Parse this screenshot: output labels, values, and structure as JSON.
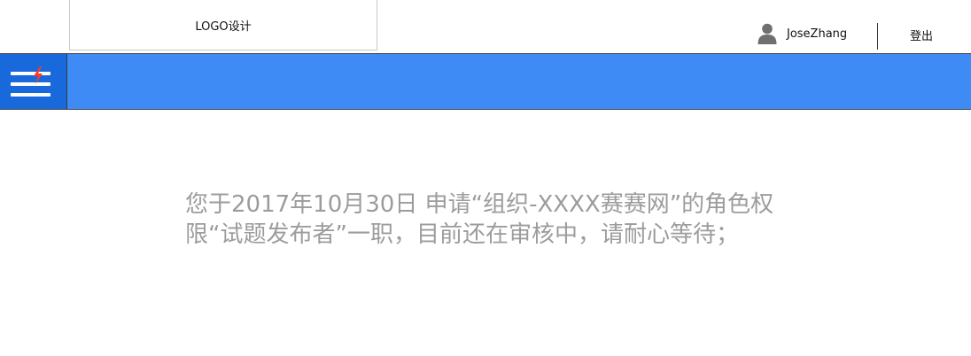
{
  "header": {
    "logo_text": "LOGO设计",
    "user_name": "JoseZhang",
    "user_icon": "user-icon",
    "logout_label": "登出"
  },
  "nav": {
    "menu_icon": "hamburger-menu-icon",
    "badge_icon": "lightning-icon",
    "colors": {
      "bar": "#3e8bf6",
      "menu_button": "#1769dc",
      "badge": "#ff3b1f"
    }
  },
  "main": {
    "message_line1": "您于2017年10月30日 申请“组织-XXXX赛赛网”的角色权",
    "message_line2": "限“试题发布者”一职，目前还在审核中，请耐心等待；"
  }
}
